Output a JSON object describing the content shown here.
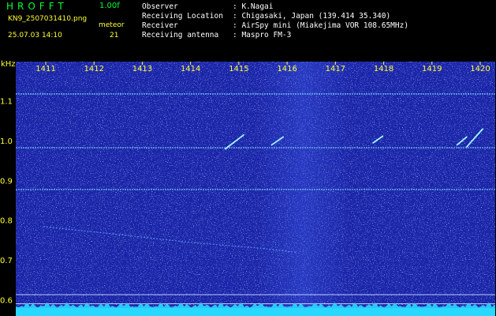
{
  "header": {
    "app_title": "HROFFT",
    "version": "1.00f",
    "filename": "KN9_2507031410.png",
    "mode": "meteor",
    "timestamp": "25.07.03 14:10",
    "count": "21",
    "info": [
      {
        "label": "Observer",
        "value": ": K.Nagai"
      },
      {
        "label": "Receiving Location",
        "value": ": Chigasaki, Japan (139.414 35.340)"
      },
      {
        "label": "Receiver",
        "value": ": AirSpy mini (Miakejima VOR 108.65MHz)"
      },
      {
        "label": "Receiving antenna",
        "value": ": Maspro FM-3"
      }
    ]
  },
  "colors": {
    "background": "#1a24a8",
    "header_bg": "#000000",
    "label_green": "#00ff33",
    "label_yellow": "#ffff33",
    "trace_cyan": "#66ffff"
  },
  "chart_data": {
    "type": "heatmap",
    "x_ticks": [
      "1411",
      "1412",
      "1413",
      "1414",
      "1415",
      "1416",
      "1417",
      "1418",
      "1419",
      "1420"
    ],
    "y_unit": "kHz",
    "y_ticks": [
      "1.1",
      "1.0",
      "0.9",
      "0.8",
      "0.7",
      "0.6"
    ],
    "y_values": [
      1.1,
      1.0,
      0.9,
      0.8,
      0.7,
      0.6
    ],
    "ylim": [
      0.56,
      1.18
    ],
    "horizontal_lines_khz": [
      1.118,
      0.983,
      0.878,
      0.614,
      0.591
    ],
    "meteor_echoes": [
      {
        "x_start": 1414.72,
        "x_end": 1415.1,
        "f_start": 0.98,
        "f_end": 1.015
      },
      {
        "x_start": 1415.68,
        "x_end": 1415.92,
        "f_start": 0.99,
        "f_end": 1.01
      },
      {
        "x_start": 1417.78,
        "x_end": 1417.98,
        "f_start": 0.995,
        "f_end": 1.012
      },
      {
        "x_start": 1419.52,
        "x_end": 1419.72,
        "f_start": 0.99,
        "f_end": 1.01
      },
      {
        "x_start": 1419.72,
        "x_end": 1420.05,
        "f_start": 0.985,
        "f_end": 1.03
      }
    ],
    "drift_trace": [
      [
        1410.95,
        0.785
      ],
      [
        1412.5,
        0.765
      ],
      [
        1414.0,
        0.745
      ],
      [
        1415.5,
        0.73
      ],
      [
        1416.2,
        0.72
      ]
    ]
  }
}
